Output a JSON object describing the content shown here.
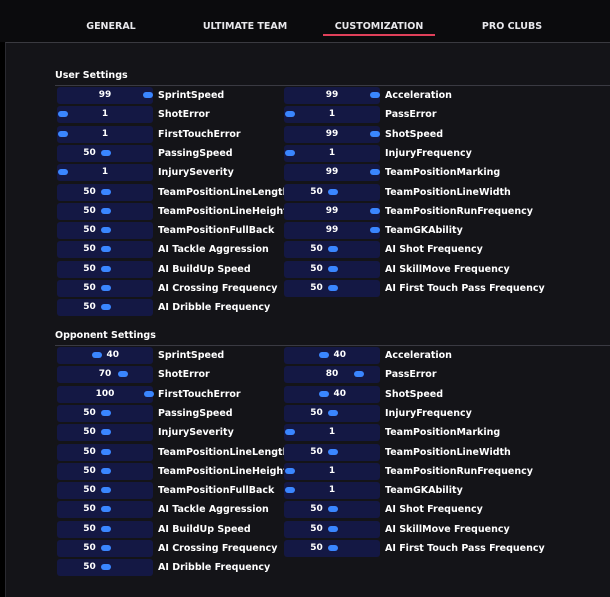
{
  "tabs": [
    {
      "label": "GENERAL",
      "active": false
    },
    {
      "label": "ULTIMATE TEAM",
      "active": false
    },
    {
      "label": "CUSTOMIZATION",
      "active": true
    },
    {
      "label": "PRO CLUBS",
      "active": false
    }
  ],
  "colors": {
    "accent": "#e0405a",
    "slider_bg": "#141844",
    "slider_thumb": "#3a86ff"
  },
  "sections": [
    {
      "title": "User Settings",
      "left": [
        {
          "label": "SprintSpeed",
          "value": 99,
          "max": 100
        },
        {
          "label": "ShotError",
          "value": 1,
          "max": 100
        },
        {
          "label": "FirstTouchError",
          "value": 1,
          "max": 100
        },
        {
          "label": "PassingSpeed",
          "value": 50,
          "max": 100
        },
        {
          "label": "InjurySeverity",
          "value": 1,
          "max": 100
        },
        {
          "label": "TeamPositionLineLength",
          "value": 50,
          "max": 100
        },
        {
          "label": "TeamPositionLineHeight",
          "value": 50,
          "max": 100
        },
        {
          "label": "TeamPositionFullBack",
          "value": 50,
          "max": 100
        },
        {
          "label": "AI Tackle Aggression",
          "value": 50,
          "max": 100
        },
        {
          "label": "AI BuildUp Speed",
          "value": 50,
          "max": 100
        },
        {
          "label": "AI Crossing Frequency",
          "value": 50,
          "max": 100
        },
        {
          "label": "AI Dribble Frequency",
          "value": 50,
          "max": 100
        }
      ],
      "right": [
        {
          "label": "Acceleration",
          "value": 99,
          "max": 100
        },
        {
          "label": "PassError",
          "value": 1,
          "max": 100
        },
        {
          "label": "ShotSpeed",
          "value": 99,
          "max": 100
        },
        {
          "label": "InjuryFrequency",
          "value": 1,
          "max": 100
        },
        {
          "label": "TeamPositionMarking",
          "value": 99,
          "max": 100
        },
        {
          "label": "TeamPositionLineWidth",
          "value": 50,
          "max": 100
        },
        {
          "label": "TeamPositionRunFrequency",
          "value": 99,
          "max": 100
        },
        {
          "label": "TeamGKAbility",
          "value": 99,
          "max": 100
        },
        {
          "label": "AI Shot Frequency",
          "value": 50,
          "max": 100
        },
        {
          "label": "AI SkillMove Frequency",
          "value": 50,
          "max": 100
        },
        {
          "label": "AI First Touch Pass Frequency",
          "value": 50,
          "max": 100
        }
      ]
    },
    {
      "title": "Opponent Settings",
      "left": [
        {
          "label": "SprintSpeed",
          "value": 40,
          "max": 100
        },
        {
          "label": "ShotError",
          "value": 70,
          "max": 100
        },
        {
          "label": "FirstTouchError",
          "value": 100,
          "max": 100
        },
        {
          "label": "PassingSpeed",
          "value": 50,
          "max": 100
        },
        {
          "label": "InjurySeverity",
          "value": 50,
          "max": 100
        },
        {
          "label": "TeamPositionLineLength",
          "value": 50,
          "max": 100
        },
        {
          "label": "TeamPositionLineHeight",
          "value": 50,
          "max": 100
        },
        {
          "label": "TeamPositionFullBack",
          "value": 50,
          "max": 100
        },
        {
          "label": "AI Tackle Aggression",
          "value": 50,
          "max": 100
        },
        {
          "label": "AI BuildUp Speed",
          "value": 50,
          "max": 100
        },
        {
          "label": "AI Crossing Frequency",
          "value": 50,
          "max": 100
        },
        {
          "label": "AI Dribble Frequency",
          "value": 50,
          "max": 100
        }
      ],
      "right": [
        {
          "label": "Acceleration",
          "value": 40,
          "max": 100
        },
        {
          "label": "PassError",
          "value": 80,
          "max": 100
        },
        {
          "label": "ShotSpeed",
          "value": 40,
          "max": 100
        },
        {
          "label": "InjuryFrequency",
          "value": 50,
          "max": 100
        },
        {
          "label": "TeamPositionMarking",
          "value": 1,
          "max": 100
        },
        {
          "label": "TeamPositionLineWidth",
          "value": 50,
          "max": 100
        },
        {
          "label": "TeamPositionRunFrequency",
          "value": 1,
          "max": 100
        },
        {
          "label": "TeamGKAbility",
          "value": 1,
          "max": 100
        },
        {
          "label": "AI Shot Frequency",
          "value": 50,
          "max": 100
        },
        {
          "label": "AI SkillMove Frequency",
          "value": 50,
          "max": 100
        },
        {
          "label": "AI First Touch Pass Frequency",
          "value": 50,
          "max": 100
        }
      ]
    }
  ]
}
